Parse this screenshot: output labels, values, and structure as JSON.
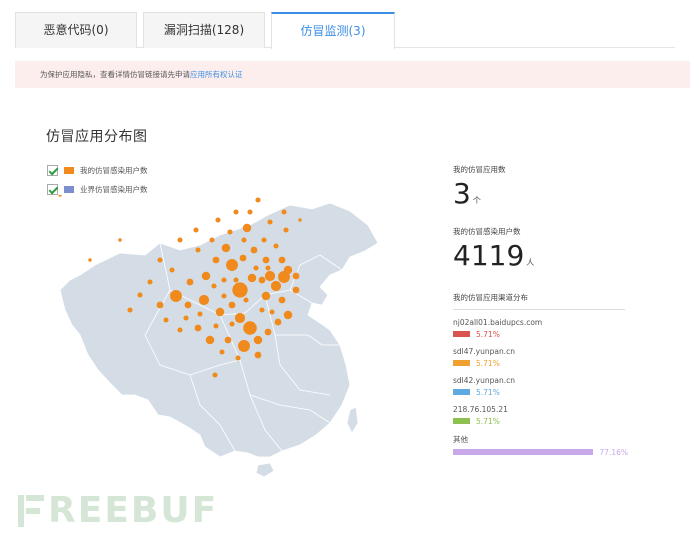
{
  "tabs": [
    {
      "label": "恶意代码(0)"
    },
    {
      "label": "漏洞扫描(128)"
    },
    {
      "label": "仿冒监测(3)"
    }
  ],
  "notice": {
    "text": "为保护应用隐私，查看详情仿冒链接请先申请",
    "link": "应用所有权认证"
  },
  "section": {
    "title": "仿冒应用分布图"
  },
  "legend": [
    {
      "label": "我的仿冒感染用户数",
      "color": "#f08a1c"
    },
    {
      "label": "业界仿冒感染用户数",
      "color": "#7b8fcf"
    }
  ],
  "stats": {
    "apps_label": "我的仿冒应用数",
    "apps_value": "3",
    "apps_unit": "个",
    "users_label": "我的仿冒感染用户数",
    "users_value": "4119",
    "users_unit": "人",
    "dist_title": "我的仿冒应用渠道分布"
  },
  "distribution": [
    {
      "name": "nj02all01.baidupcs.com",
      "pct": "5.71%",
      "fraction": 0.0571,
      "color": "#d9534f"
    },
    {
      "name": "sdl47.yunpan.cn",
      "pct": "5.71%",
      "fraction": 0.0571,
      "color": "#f0a030"
    },
    {
      "name": "sdl42.yunpan.cn",
      "pct": "5.71%",
      "fraction": 0.0571,
      "color": "#5fa8e0"
    },
    {
      "name": "218.76.105.21",
      "pct": "5.71%",
      "fraction": 0.0571,
      "color": "#8cc152"
    },
    {
      "name": "其他",
      "pct": "77.16%",
      "fraction": 0.7716,
      "color": "#c8a8e8"
    }
  ],
  "watermark": {
    "text": "REEBUF"
  },
  "colors": {
    "accent": "#3a8ee6",
    "dot": "#f08a1c",
    "map": "#d4dde6"
  }
}
